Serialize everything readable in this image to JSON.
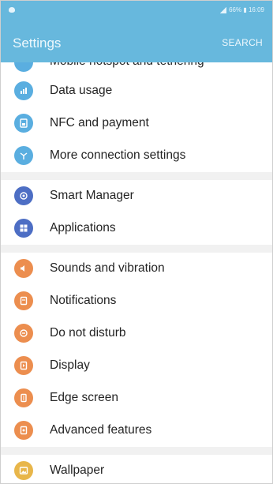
{
  "status_bar": {
    "time_text": "66% ▮ 16:09"
  },
  "app_bar": {
    "title": "Settings",
    "search_label": "SEARCH"
  },
  "colors": {
    "accent": "#67b8dd",
    "blue_icon": "#5aaee0",
    "indigo_icon": "#4d6ec4",
    "orange_icon": "#ec8e4f",
    "yellow_icon": "#e8b64a"
  },
  "sections": [
    {
      "items": [
        {
          "label": "Mobile hotspot and tethering",
          "icon": "hotspot-icon",
          "partial": true
        },
        {
          "label": "Data usage",
          "icon": "data-usage-icon"
        },
        {
          "label": "NFC and payment",
          "icon": "nfc-icon"
        },
        {
          "label": "More connection settings",
          "icon": "more-connection-icon"
        }
      ]
    },
    {
      "items": [
        {
          "label": "Smart Manager",
          "icon": "smart-manager-icon"
        },
        {
          "label": "Applications",
          "icon": "applications-icon"
        }
      ]
    },
    {
      "items": [
        {
          "label": "Sounds and vibration",
          "icon": "sound-icon"
        },
        {
          "label": "Notifications",
          "icon": "notifications-icon"
        },
        {
          "label": "Do not disturb",
          "icon": "do-not-disturb-icon"
        },
        {
          "label": "Display",
          "icon": "display-icon"
        },
        {
          "label": "Edge screen",
          "icon": "edge-screen-icon"
        },
        {
          "label": "Advanced features",
          "icon": "advanced-features-icon"
        }
      ]
    },
    {
      "items": [
        {
          "label": "Wallpaper",
          "icon": "wallpaper-icon"
        }
      ]
    }
  ]
}
